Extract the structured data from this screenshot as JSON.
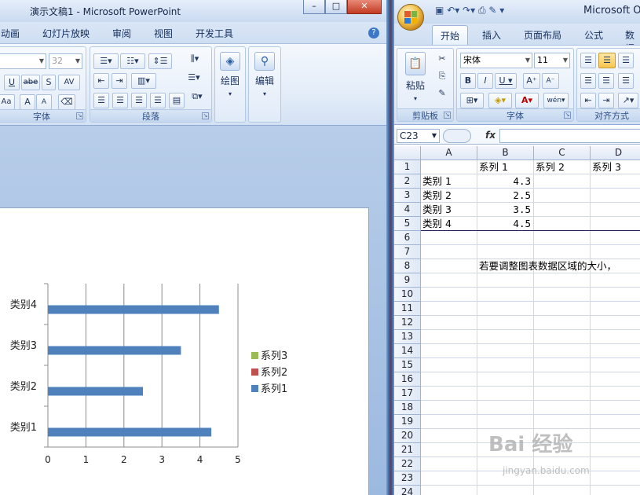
{
  "ppt": {
    "title": "演示文稿1 - Microsoft PowerPoint",
    "tabs": [
      "动画",
      "幻灯片放映",
      "审阅",
      "视图",
      "开发工具"
    ],
    "font_size": "32",
    "groups": {
      "font": "字体",
      "paragraph": "段落"
    },
    "buttons": {
      "drawing": "绘图",
      "editing": "编辑"
    },
    "font_buttons": [
      "U",
      "abe",
      "S",
      "AV",
      "Aa",
      "A",
      "A"
    ]
  },
  "xl": {
    "title": "Microsoft O",
    "tabs": [
      "开始",
      "插入",
      "页面布局",
      "公式",
      "数据"
    ],
    "active_tab": "开始",
    "font_name": "宋体",
    "font_size": "11",
    "groups": {
      "clipboard": "剪贴板",
      "font": "字体",
      "alignment": "对齐方式"
    },
    "paste_label": "粘贴",
    "name_box": "C23",
    "fx": "fx",
    "columns": [
      "A",
      "B",
      "C",
      "D"
    ],
    "rows": [
      "1",
      "2",
      "3",
      "4",
      "5",
      "6",
      "7",
      "8",
      "9",
      "10",
      "11",
      "12",
      "13",
      "14",
      "15",
      "16",
      "17",
      "18",
      "19",
      "20",
      "21",
      "22",
      "23",
      "24"
    ],
    "cells": {
      "B1": "系列 1",
      "C1": "系列 2",
      "D1": "系列 3",
      "A2": "类别 1",
      "B2": "4.3",
      "A3": "类别 2",
      "B3": "2.5",
      "A4": "类别 3",
      "B4": "3.5",
      "A5": "类别 4",
      "B5": "4.5",
      "B8": "若要调整图表数据区域的大小，"
    }
  },
  "chart_data": {
    "type": "bar",
    "orientation": "horizontal",
    "categories": [
      "类别1",
      "类别2",
      "类别3",
      "类别4"
    ],
    "series": [
      {
        "name": "系列1",
        "values": [
          4.3,
          2.5,
          3.5,
          4.5
        ],
        "color": "#4f81bd"
      },
      {
        "name": "系列2",
        "values": [],
        "color": "#c0504d"
      },
      {
        "name": "系列3",
        "values": [],
        "color": "#9bbb59"
      }
    ],
    "xlim": [
      0,
      5
    ],
    "xticks": [
      "0",
      "1",
      "2",
      "3",
      "4",
      "5"
    ],
    "grid": true,
    "legend": "right"
  },
  "watermark": {
    "brand": "Bai  经验",
    "url": "jingyan.baidu.com"
  }
}
